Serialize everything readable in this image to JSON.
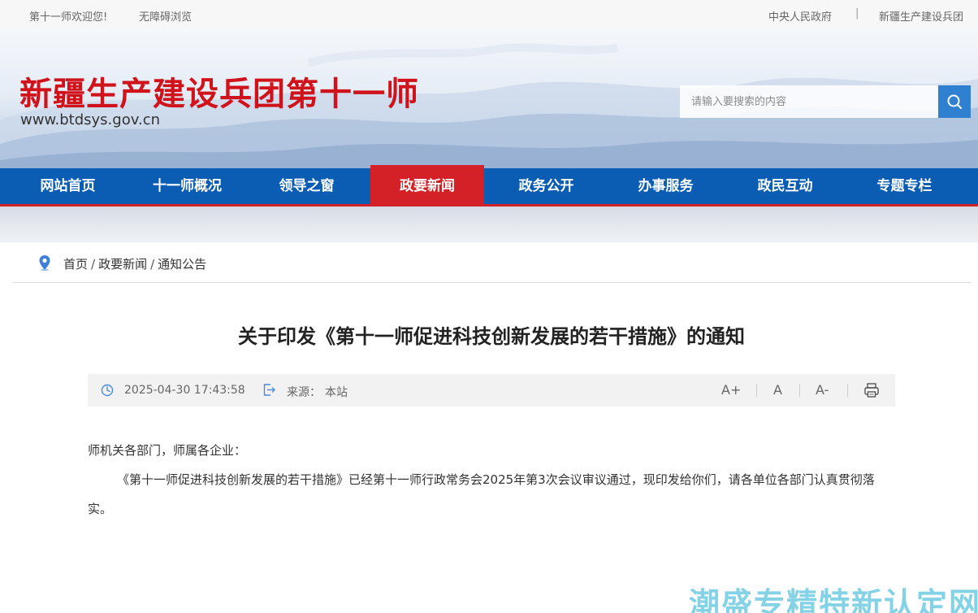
{
  "topbar": {
    "welcome": "第十一师欢迎您!",
    "accessibility": "无障碍浏览",
    "link_central_gov": "中央人民政府",
    "separator": "|",
    "link_corps": "新疆生产建设兵团"
  },
  "header": {
    "site_title": "新疆生产建设兵团第十一师",
    "site_url": "www.btdsys.gov.cn",
    "search_placeholder": "请输入要搜索的内容",
    "search_icon": "search-icon"
  },
  "nav": {
    "items": [
      {
        "label": "网站首页"
      },
      {
        "label": "十一师概况"
      },
      {
        "label": "领导之窗"
      },
      {
        "label": "政要新闻"
      },
      {
        "label": "政务公开"
      },
      {
        "label": "办事服务"
      },
      {
        "label": "政民互动"
      },
      {
        "label": "专题专栏"
      }
    ],
    "active_index": 3
  },
  "breadcrumb": {
    "icon": "location-pin-icon",
    "items": [
      "首页",
      "政要新闻",
      "通知公告"
    ],
    "separator": "/"
  },
  "article": {
    "title": "关于印发《第十一师促进科技创新发展的若干措施》的通知",
    "datetime": "2025-04-30 17:43:58",
    "source_label": "来源：",
    "source": "本站",
    "font_large": "A+",
    "font_normal": "A",
    "font_small": "A-",
    "paragraphs": [
      "师机关各部门，师属各企业：",
      "《第十一师促进科技创新发展的若干措施》已经第十一师行政常务会2025年第3次会议审议通过，现印发给你们，请各单位各部门认真贯彻落实。"
    ]
  },
  "watermark": "潮盛专精特新认定网",
  "colors": {
    "brand_red": "#d0121b",
    "nav_blue": "#0b5db4",
    "nav_active": "#d42127",
    "search_button": "#2f80d0"
  }
}
